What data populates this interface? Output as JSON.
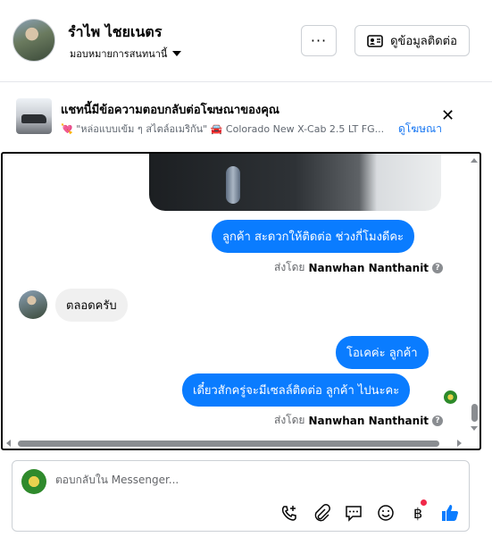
{
  "header": {
    "contact_name": "รำไพ ไชยเนตร",
    "assign_label": "มอบหมายการสนทนานี้",
    "more_label": "···",
    "contact_info_label": "ดูข้อมูลติดต่อ"
  },
  "ad_banner": {
    "title": "แชทนี้มีข้อความตอบกลับต่อโฆษณาของคุณ",
    "subtitle": "💘 \"หล่อแบบเข้ม ๆ สไตล์อเมริกัน\" 🚘 Colorado New X-Cab 2.5 LT FG...",
    "view_ad_link": "ดูโฆษณา",
    "close_label": "✕"
  },
  "messages": [
    {
      "from": "page",
      "text": "ลูกค้า สะดวกให้ติดต่อ ช่วงกี่โมงดีคะ"
    },
    {
      "sent_by_prefix": "ส่งโดย",
      "sent_by_name": "Nanwhan Nanthanit"
    },
    {
      "from": "customer",
      "text": "ตลอดครับ"
    },
    {
      "from": "page",
      "text": "โอเคค่ะ  ลูกค้า"
    },
    {
      "from": "page",
      "text": "เดี๋ยวสักครู่จะมีเซลล์ติดต่อ ลูกค้า ไปนะคะ"
    },
    {
      "sent_by_prefix": "ส่งโดย",
      "sent_by_name": "Nanwhan Nanthanit"
    }
  ],
  "composer": {
    "placeholder": "ตอบกลับใน Messenger..."
  },
  "icons": [
    "phone-add-icon",
    "paperclip-icon",
    "saved-reply-icon",
    "emoji-icon",
    "baht-icon",
    "thumbs-up-icon"
  ],
  "colors": {
    "outgoing_bubble": "#0a7cff",
    "incoming_bubble": "#f0f0f0",
    "link": "#1877f2",
    "like": "#0a7cff"
  }
}
